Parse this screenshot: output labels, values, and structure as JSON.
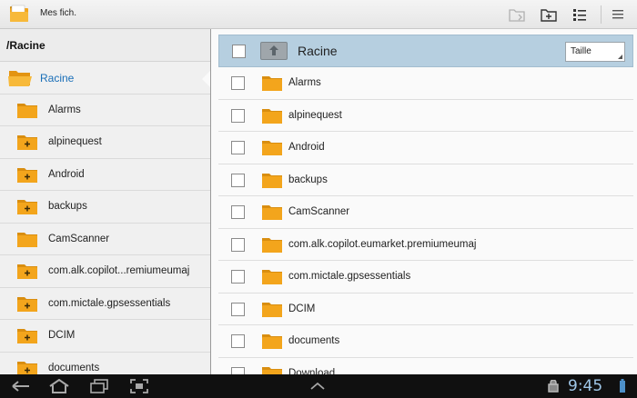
{
  "app": {
    "title": "Mes fich."
  },
  "actionbar": {
    "icons": [
      "folder-move-icon",
      "new-folder-icon",
      "list-view-icon",
      "overflow-menu-icon"
    ]
  },
  "left": {
    "path": "/Racine",
    "root_label": "Racine",
    "items": [
      {
        "label": "Alarms",
        "has_children": false
      },
      {
        "label": "alpinequest",
        "has_children": true
      },
      {
        "label": "Android",
        "has_children": true
      },
      {
        "label": "backups",
        "has_children": true
      },
      {
        "label": "CamScanner",
        "has_children": false
      },
      {
        "label": "com.alk.copilot...remiumeumaj",
        "has_children": true
      },
      {
        "label": "com.mictale.gpsessentials",
        "has_children": true
      },
      {
        "label": "DCIM",
        "has_children": true
      },
      {
        "label": "documents",
        "has_children": true
      }
    ]
  },
  "right": {
    "title": "Racine",
    "sort_label": "Taille",
    "files": [
      "Alarms",
      "alpinequest",
      "Android",
      "backups",
      "CamScanner",
      "com.alk.copilot.eumarket.premiumeumaj",
      "com.mictale.gpsessentials",
      "DCIM",
      "documents",
      "Download"
    ]
  },
  "system": {
    "clock": "9:45"
  },
  "colors": {
    "folder": "#f3a51c",
    "accent": "#1a6fb8",
    "header_bg": "#b6cfe0"
  }
}
